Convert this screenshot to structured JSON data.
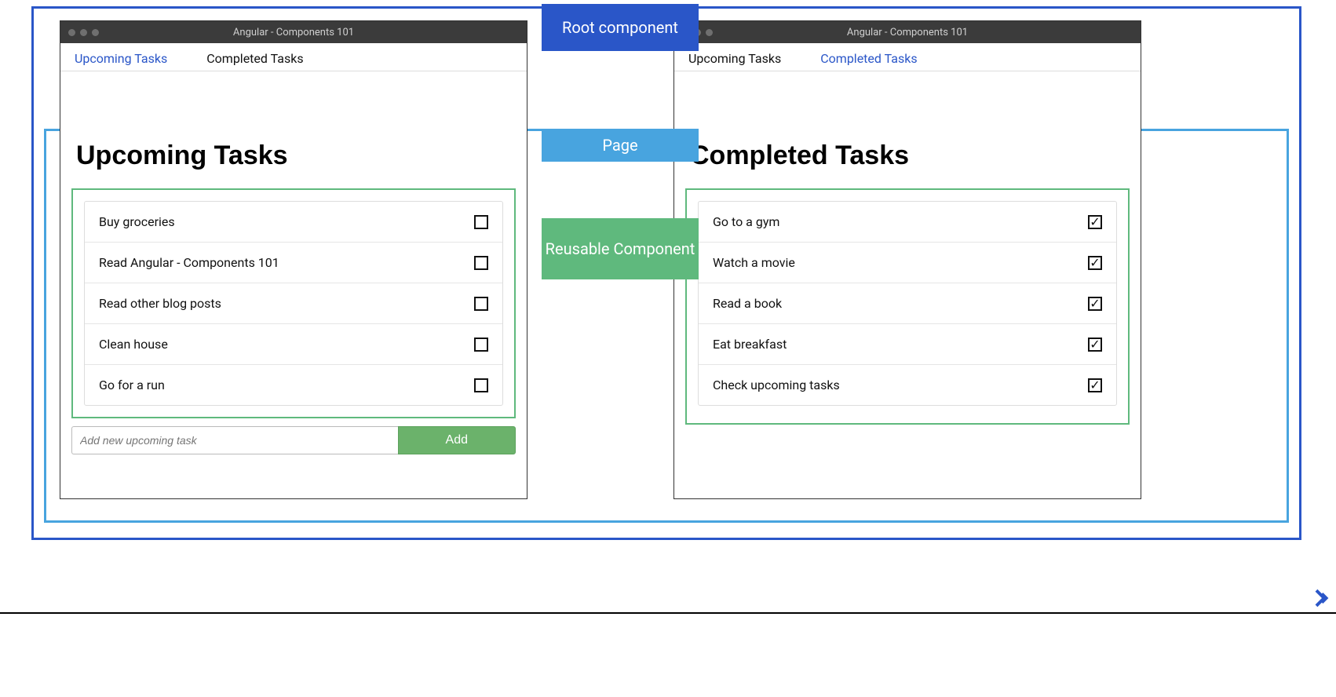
{
  "labels": {
    "root": "Root component",
    "page": "Page",
    "component": "Reusable Component"
  },
  "windowTitle": "Angular - Components 101",
  "tabs": {
    "upcoming": "Upcoming Tasks",
    "completed": "Completed Tasks"
  },
  "left": {
    "pageTitle": "Upcoming Tasks",
    "tasks": [
      {
        "label": "Buy groceries",
        "checked": false
      },
      {
        "label": "Read Angular - Components 101",
        "checked": false
      },
      {
        "label": "Read other blog posts",
        "checked": false
      },
      {
        "label": "Clean house",
        "checked": false
      },
      {
        "label": "Go for a run",
        "checked": false
      }
    ],
    "addPlaceholder": "Add new upcoming task",
    "addLabel": "Add"
  },
  "right": {
    "pageTitle": "Completed Tasks",
    "tasks": [
      {
        "label": "Go to a gym",
        "checked": true
      },
      {
        "label": "Watch a movie",
        "checked": true
      },
      {
        "label": "Read a book",
        "checked": true
      },
      {
        "label": "Eat breakfast",
        "checked": true
      },
      {
        "label": "Check upcoming tasks",
        "checked": true
      }
    ]
  }
}
